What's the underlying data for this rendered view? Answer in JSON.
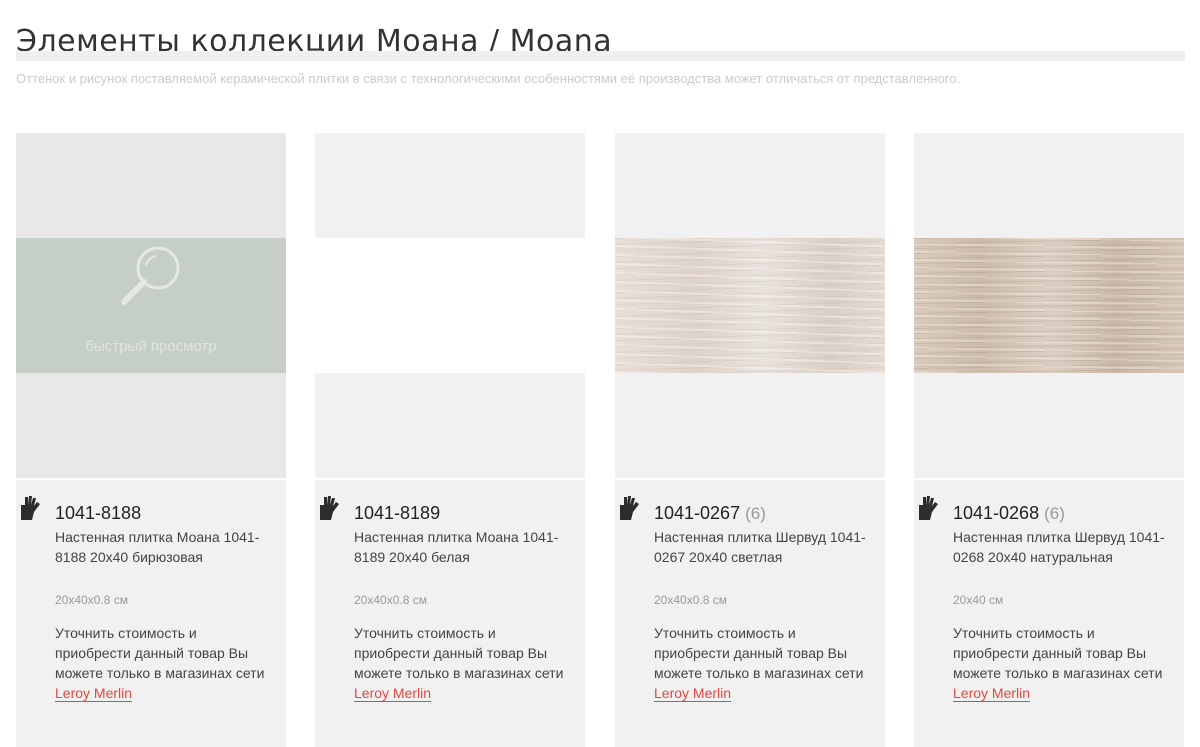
{
  "title": "Элементы коллекции Моана / Moana",
  "disclaimer": "Оттенок и рисунок поставляемой керамической плитки в связи с технологическими особенностями её производства может отличаться от представленного.",
  "quick_view_label": "быстрый просмотр",
  "products": [
    {
      "sku": "1041-8188",
      "count": "",
      "desc": "Настенная плитка Моана 1041-8188 20x40 бирюзовая",
      "size": "20x40x0.8 см",
      "note_text": "Уточнить стоимость и приобрести данный товар Вы можете только в магазинах сети ",
      "store_link": "Leroy Merlin"
    },
    {
      "sku": "1041-8189",
      "count": "",
      "desc": "Настенная плитка Моана 1041-8189 20x40 белая",
      "size": "20x40x0.8 см",
      "note_text": "Уточнить стоимость и приобрести данный товар Вы можете только в магазинах сети ",
      "store_link": "Leroy Merlin"
    },
    {
      "sku": "1041-0267",
      "count": "(6)",
      "desc": "Настенная плитка Шервуд 1041-0267 20x40 светлая",
      "size": "20x40x0.8 см",
      "note_text": "Уточнить стоимость и приобрести данный товар Вы можете только в магазинах сети ",
      "store_link": "Leroy Merlin"
    },
    {
      "sku": "1041-0268",
      "count": "(6)",
      "desc": "Настенная плитка Шервуд 1041-0268 20x40 натуральная",
      "size": "20x40 см",
      "note_text": "Уточнить стоимость и приобрести данный товар Вы можете только в магазинах сети ",
      "store_link": "Leroy Merlin"
    }
  ],
  "colors": {
    "link": "#e0493f",
    "card_bg": "#f1f1f1",
    "quick_view_bg": "#c6cfc6"
  },
  "icons": {
    "product_badge": "hand-icon",
    "quick_view": "magnifier-icon"
  }
}
